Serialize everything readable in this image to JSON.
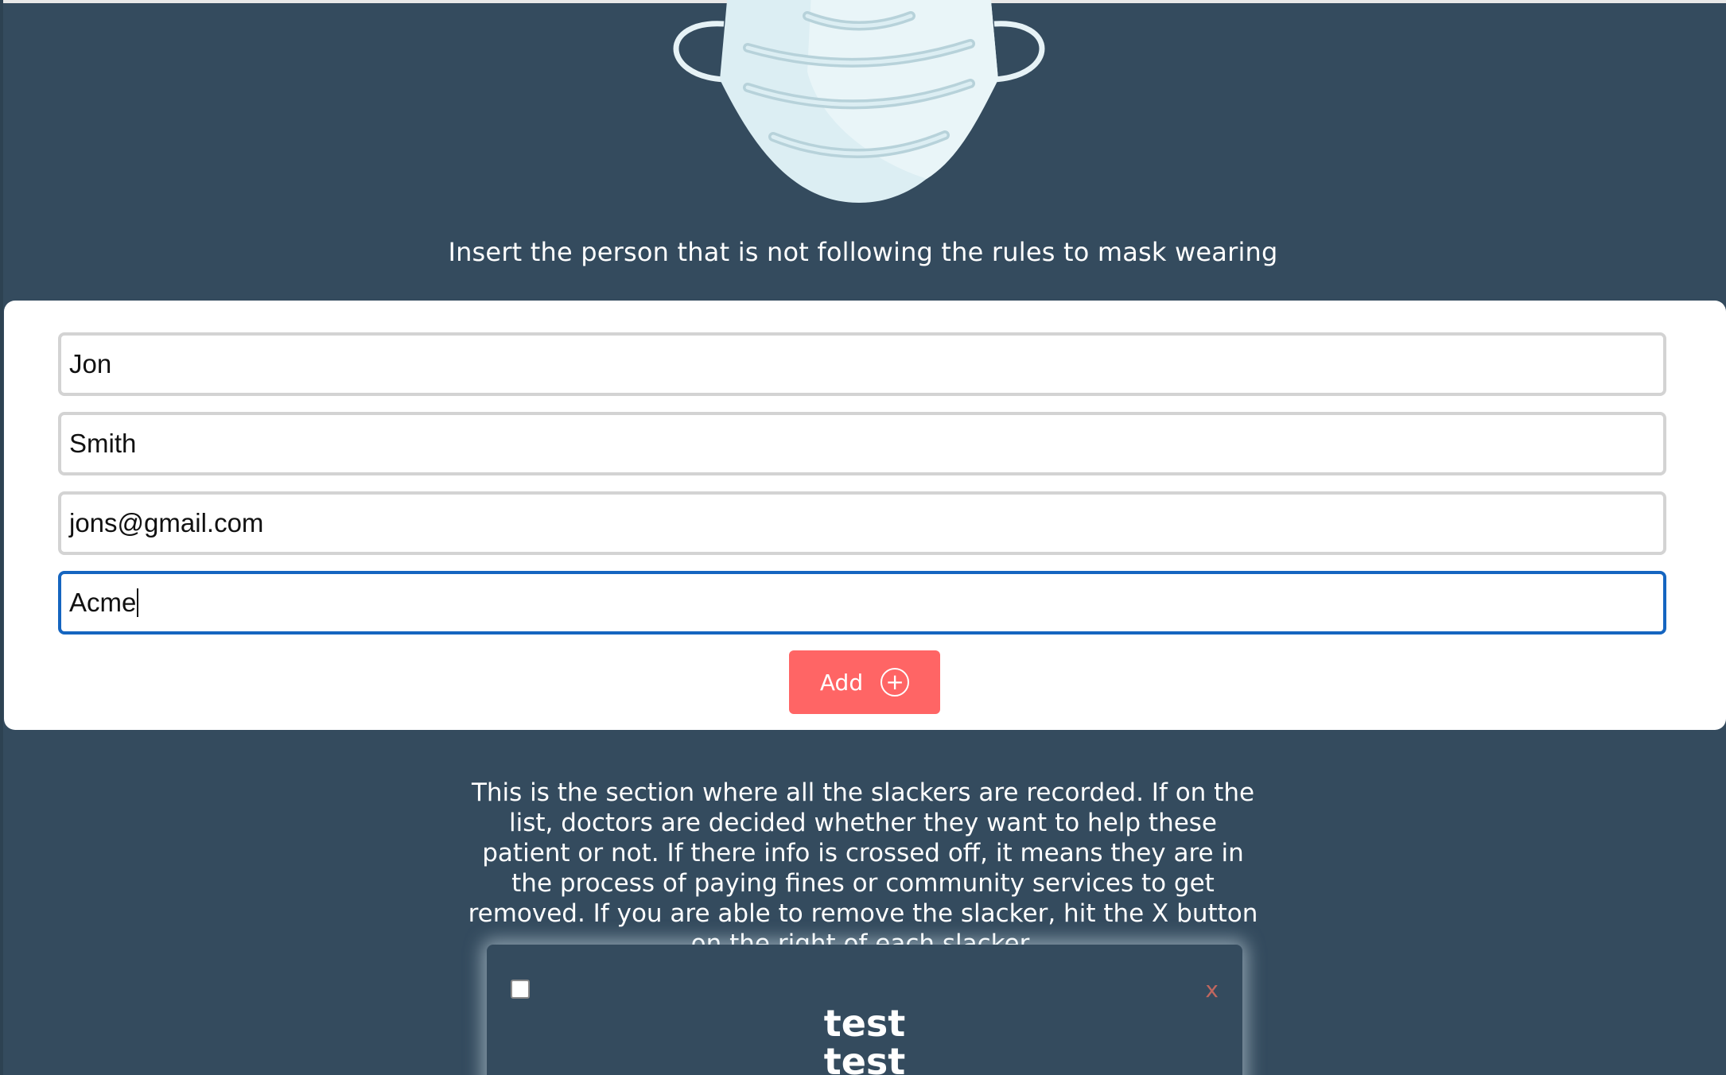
{
  "header": {
    "prompt": "Insert the person that is not following the rules to mask wearing"
  },
  "form": {
    "fields": [
      {
        "value": "Jon"
      },
      {
        "value": "Smith"
      },
      {
        "value": "jons@gmail.com"
      },
      {
        "value": "Acme",
        "focused": true
      }
    ],
    "add_label": "Add",
    "add_icon": "plus-circle-icon"
  },
  "info": {
    "text": "This is the section where all the slackers are recorded. If on the list, doctors are decided whether they want to help these patient or not. If there info is crossed off, it means they are in the process of paying fines or community services to get removed. If you are able to remove the slacker, hit the X button on the right of each slacker."
  },
  "slackers": [
    {
      "first": "test",
      "last": "test",
      "remove_label": "X"
    }
  ],
  "colors": {
    "background": "#344b5e",
    "card": "#ffffff",
    "accent_button": "#ff6565",
    "focus_border": "#1565c0",
    "remove_x": "#c0675f"
  }
}
